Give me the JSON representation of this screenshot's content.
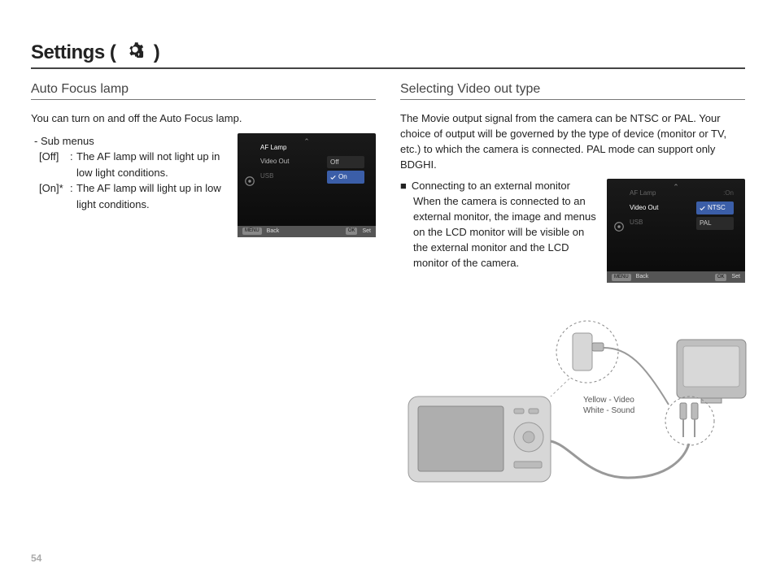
{
  "page_number": "54",
  "title_prefix": "Settings (",
  "title_suffix": ")",
  "left": {
    "heading": "Auto Focus lamp",
    "intro": "You can turn on and off the Auto Focus lamp.",
    "submenu_label": "- Sub menus",
    "defs": [
      {
        "key": "[Off]",
        "val": "The AF lamp will not light up in low light conditions."
      },
      {
        "key": "[On]*",
        "val": "The AF lamp will light up in low light conditions."
      }
    ],
    "lcd": {
      "items": [
        "AF Lamp",
        "Video Out",
        "USB"
      ],
      "right_dim": "",
      "opts": [
        "Off",
        "On"
      ],
      "active_index": 1,
      "footer_back": "Back",
      "footer_set": "Set",
      "footer_menu": "MENU",
      "footer_ok": "OK"
    }
  },
  "right": {
    "heading": "Selecting Video out type",
    "intro": "The Movie output signal from the camera can be NTSC or PAL. Your choice of output will be governed by the type of device (monitor or TV, etc.) to which the camera is connected. PAL mode can support only BDGHI.",
    "bullet_title": "Connecting to an external monitor",
    "bullet_body": "When the camera is connected to an external monitor, the image and menus on the LCD monitor will be visible on the external monitor and the LCD monitor of the camera.",
    "lcd": {
      "items": [
        "AF Lamp",
        "Video Out",
        "USB"
      ],
      "right_dim": ":On",
      "opts": [
        "NTSC",
        "PAL"
      ],
      "active_index": 0,
      "footer_back": "Back",
      "footer_set": "Set",
      "footer_menu": "MENU",
      "footer_ok": "OK"
    },
    "cable_label_1": "Yellow - Video",
    "cable_label_2": "White - Sound"
  }
}
